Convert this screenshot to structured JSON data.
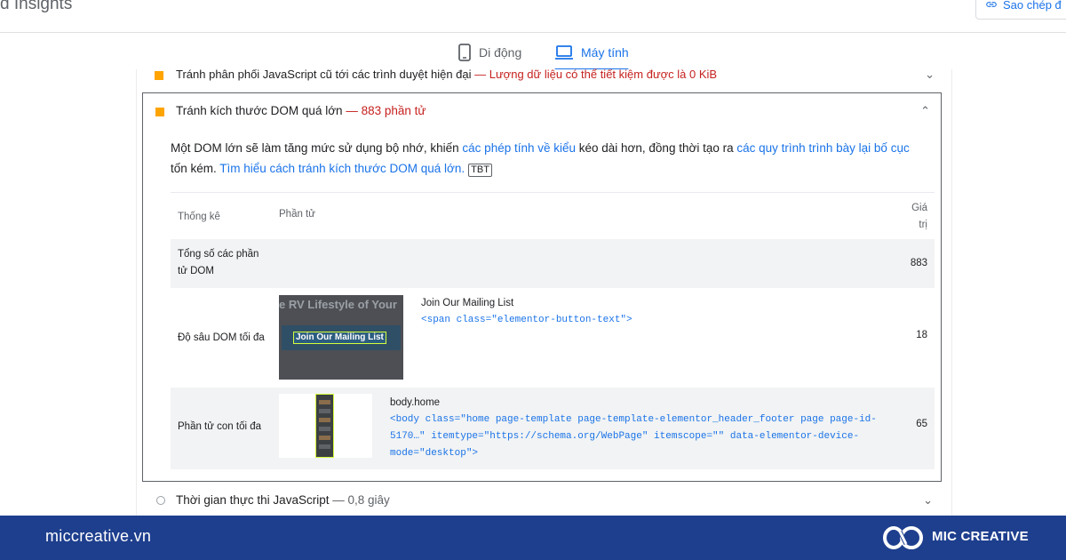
{
  "header": {
    "title": "d Insights",
    "copy_link_label": "Sao chép đ"
  },
  "tabs": [
    {
      "label": "Di động",
      "icon": "phone-icon",
      "active": false
    },
    {
      "label": "Máy tính",
      "icon": "laptop-icon",
      "active": true
    }
  ],
  "audit_prev": {
    "title": "Tránh phân phối JavaScript cũ tới các trình duyệt hiện đại",
    "savings": "— Lượng dữ liệu có thể tiết kiệm được là 0 KiB",
    "status_color": "#ffa400"
  },
  "audit": {
    "title": "Tránh kích thước DOM quá lớn",
    "savings": "— 883 phần tử",
    "desc_part1": "Một DOM lớn sẽ làm tăng mức sử dụng bộ nhớ, khiến ",
    "desc_link1": "các phép tính về kiểu",
    "desc_part2": " kéo dài hơn, đồng thời tạo ra ",
    "desc_link2": "các quy trình trình bày lại bố cục",
    "desc_part3": " tốn kém. ",
    "desc_link3": "Tìm hiểu cách tránh kích thước DOM quá lớn.",
    "badge": "TBT",
    "table": {
      "headers": {
        "stat": "Thống kê",
        "element": "Phần tử",
        "value": "Giá trị"
      },
      "rows": [
        {
          "stat": "Tổng số các phần tử DOM",
          "value": "883"
        },
        {
          "stat": "Độ sâu DOM tối đa",
          "value": "18",
          "thumb_hero": "e RV Lifestyle of Your",
          "thumb_button": "Join Our Mailing List",
          "element_text": "Join Our Mailing List",
          "element_code": "<span class=\"elementor-button-text\">"
        },
        {
          "stat": "Phần tử con tối đa",
          "value": "65",
          "element_text": "body.home",
          "element_code": "<body class=\"home page-template page-template-elementor_header_footer page page-id-5170…\" itemtype=\"https://schema.org/WebPage\" itemscope=\"\" data-elementor-device-mode=\"desktop\">"
        }
      ]
    }
  },
  "audit_next": {
    "title": "Thời gian thực thi JavaScript",
    "time": "— 0,8 giây"
  },
  "footer": {
    "site": "miccreative.vn",
    "brand": "MIC CREATIVE",
    "bg_color": "#1e3f8e"
  }
}
